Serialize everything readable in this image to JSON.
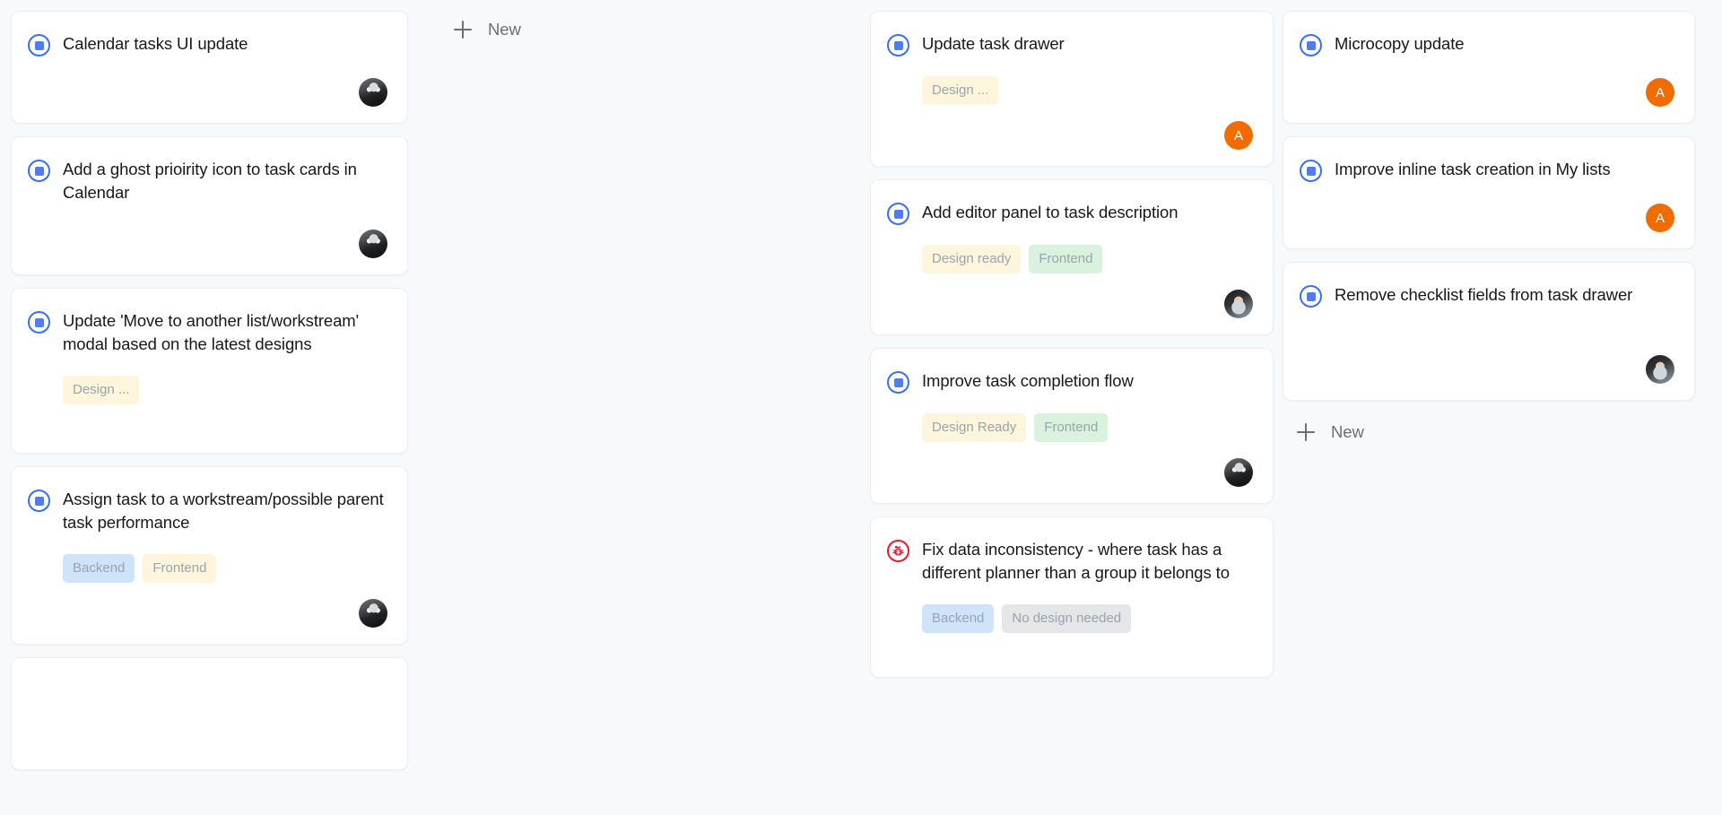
{
  "board": {
    "background_color": "#f8f9fb",
    "card_background": "#ffffff",
    "accent_color": "#4d7cf3",
    "bug_color": "#e8192c",
    "avatar_initial_color": "#ef6c00",
    "new_label": "New",
    "plus_icon": "plus-icon",
    "task_icon": "task-square-icon",
    "bug_icon": "bug-icon"
  },
  "columns": [
    {
      "id": "column-1",
      "cards": [
        {
          "title": "Calendar tasks UI update",
          "icon": "task-square-icon",
          "chips": [],
          "avatar": {
            "type": "photo",
            "style": "photo-a",
            "initial": ""
          }
        },
        {
          "title": "Add a ghost prioirity icon to task cards in Calendar",
          "icon": "task-square-icon",
          "chips": [],
          "avatar": {
            "type": "photo",
            "style": "photo-a",
            "initial": ""
          }
        },
        {
          "title": "Update 'Move to another list/workstream' modal based on the latest designs",
          "icon": "task-square-icon",
          "chips": [
            {
              "label": "Design ...",
              "color": "yellow"
            }
          ],
          "avatar": null
        },
        {
          "title": "Assign task to a workstream/possible parent task performance",
          "icon": "task-square-icon",
          "chips": [
            {
              "label": "Backend",
              "color": "blue"
            },
            {
              "label": "Frontend",
              "color": "yellow"
            }
          ],
          "avatar": {
            "type": "photo",
            "style": "photo-a",
            "initial": ""
          }
        },
        {
          "title": "",
          "icon": "task-square-icon",
          "chips": [],
          "avatar": null
        }
      ],
      "new_button": null
    },
    {
      "id": "column-2",
      "cards": [],
      "new_button": {
        "label": "New"
      }
    },
    {
      "id": "column-3",
      "cards": [
        {
          "title": "Update task drawer",
          "icon": "task-square-icon",
          "chips": [
            {
              "label": "Design ...",
              "color": "yellow"
            }
          ],
          "avatar": {
            "type": "initial",
            "style": "initial-orange",
            "initial": "A"
          }
        },
        {
          "title": "Add editor panel to task description",
          "icon": "task-square-icon",
          "chips": [
            {
              "label": "Design ready",
              "color": "yellow"
            },
            {
              "label": "Frontend",
              "color": "green"
            }
          ],
          "avatar": {
            "type": "photo",
            "style": "photo-b",
            "initial": ""
          }
        },
        {
          "title": "Improve task completion flow",
          "icon": "task-square-icon",
          "chips": [
            {
              "label": "Design Ready",
              "color": "yellow"
            },
            {
              "label": "Frontend",
              "color": "green"
            }
          ],
          "avatar": {
            "type": "photo",
            "style": "photo-a",
            "initial": ""
          }
        },
        {
          "title": "Fix data inconsistency - where task has a different planner than a group it belongs to",
          "icon": "bug-icon",
          "chips": [
            {
              "label": "Backend",
              "color": "blue"
            },
            {
              "label": "No design needed",
              "color": "gray"
            }
          ],
          "avatar": null
        }
      ],
      "new_button": null
    },
    {
      "id": "column-4",
      "cards": [
        {
          "title": "Microcopy update",
          "icon": "task-square-icon",
          "chips": [],
          "avatar": {
            "type": "initial",
            "style": "initial-orange",
            "initial": "A"
          }
        },
        {
          "title": "Improve inline task creation in My lists",
          "icon": "task-square-icon",
          "chips": [],
          "avatar": {
            "type": "initial",
            "style": "initial-orange",
            "initial": "A"
          }
        },
        {
          "title": "Remove checklist fields from task drawer",
          "icon": "task-square-icon",
          "chips": [],
          "avatar": {
            "type": "photo",
            "style": "photo-b",
            "initial": ""
          }
        }
      ],
      "new_button": {
        "label": "New"
      }
    }
  ]
}
